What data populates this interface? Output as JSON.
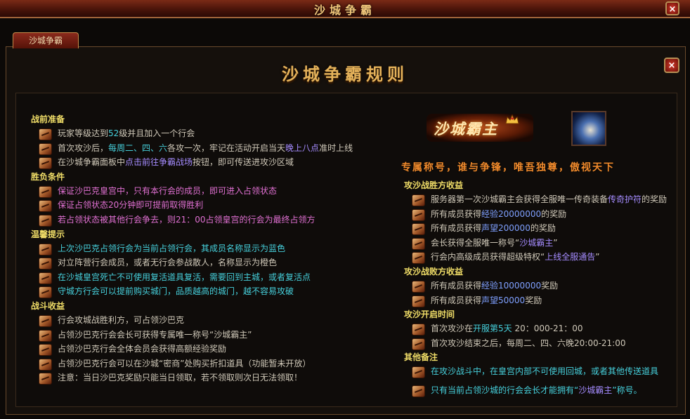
{
  "window": {
    "title": "沙城争霸",
    "close_label": "×"
  },
  "tab": {
    "label": "沙城争霸"
  },
  "panel": {
    "title": "沙城争霸规则",
    "close_label": "×"
  },
  "logo": {
    "text": "沙城霸主"
  },
  "slogan": "专属称号，谁与争锋，唯吾独尊，傲视天下",
  "left_sections": [
    {
      "heading": "战前准备",
      "items": [
        {
          "parts": [
            {
              "t": "玩家等级达到",
              "c": "white"
            },
            {
              "t": "52",
              "c": "cyan"
            },
            {
              "t": "级并且加入一个行会",
              "c": "white"
            }
          ]
        },
        {
          "parts": [
            {
              "t": "首次攻沙后，",
              "c": "white"
            },
            {
              "t": "每周二、四、六",
              "c": "cyan"
            },
            {
              "t": "各攻一次，牢记在活动开启当天",
              "c": "white"
            },
            {
              "t": "晚上八点",
              "c": "purple"
            },
            {
              "t": "准时上线",
              "c": "white"
            }
          ]
        },
        {
          "parts": [
            {
              "t": "在沙城争霸面板中",
              "c": "white"
            },
            {
              "t": "点击前往争霸战场",
              "c": "purple"
            },
            {
              "t": "按钮，即可传送进攻沙区域",
              "c": "white"
            }
          ]
        }
      ]
    },
    {
      "heading": "胜负条件",
      "items": [
        {
          "parts": [
            {
              "t": "保证沙巴克皇宫中，只有本行会的成员，即可进入占领状态",
              "c": "pink"
            }
          ]
        },
        {
          "parts": [
            {
              "t": "保证占领状态20分钟即可提前取得胜利",
              "c": "pink"
            }
          ]
        },
        {
          "parts": [
            {
              "t": "若占领状态被其他行会争去，则21：00占领皇宫的行会为最终占领方",
              "c": "pink"
            }
          ]
        }
      ]
    },
    {
      "heading": "温馨提示",
      "items": [
        {
          "parts": [
            {
              "t": "上次沙巴克占领行会为当前占领行会，其成员名称显示为蓝色",
              "c": "cyan"
            }
          ]
        },
        {
          "parts": [
            {
              "t": "对立阵营行会成员，或者无行会参战散人，名称显示为橙色",
              "c": "white"
            }
          ]
        },
        {
          "parts": [
            {
              "t": "在沙城皇宫死亡不可使用复活道具复活，需要回到主城，或者复活点",
              "c": "cyan"
            }
          ]
        },
        {
          "parts": [
            {
              "t": "守城方行会可以提前购买城门，品质越高的城门，越不容易攻破",
              "c": "cyan"
            }
          ]
        }
      ]
    },
    {
      "heading": "战斗收益",
      "items": [
        {
          "parts": [
            {
              "t": "行会攻城战胜利方，可占领沙巴克",
              "c": "white"
            }
          ]
        },
        {
          "parts": [
            {
              "t": "占领沙巴克行会会长可获得专属唯一称号“沙城霸主”",
              "c": "white"
            }
          ]
        },
        {
          "parts": [
            {
              "t": "占领沙巴克行会全体会员会获得高额经验奖励",
              "c": "white"
            }
          ]
        },
        {
          "parts": [
            {
              "t": "占领沙巴克行会可以在沙城“密商”处购买折扣道具（功能暂未开放）",
              "c": "white"
            }
          ]
        },
        {
          "parts": [
            {
              "t": "注意：当日沙巴克奖励只能当日领取，若不领取则次日无法领取！",
              "c": "white"
            }
          ]
        }
      ]
    }
  ],
  "right_sections": [
    {
      "heading": "攻沙战胜方收益",
      "items": [
        {
          "parts": [
            {
              "t": "服务器第一次沙城霸主会获得全服唯一传奇装备",
              "c": "white"
            },
            {
              "t": "传奇护符",
              "c": "purple"
            },
            {
              "t": "的奖励",
              "c": "white"
            }
          ]
        },
        {
          "parts": [
            {
              "t": "所有成员获得",
              "c": "white"
            },
            {
              "t": "经验20000000",
              "c": "blue"
            },
            {
              "t": "的奖励",
              "c": "white"
            }
          ]
        },
        {
          "parts": [
            {
              "t": "所有成员获得",
              "c": "white"
            },
            {
              "t": "声望200000",
              "c": "blue"
            },
            {
              "t": "的奖励",
              "c": "white"
            }
          ]
        },
        {
          "parts": [
            {
              "t": "会长获得全服唯一称号“",
              "c": "white"
            },
            {
              "t": "沙城霸主",
              "c": "purple"
            },
            {
              "t": "”",
              "c": "white"
            }
          ]
        },
        {
          "parts": [
            {
              "t": "行会内高级成员获得超级特权“",
              "c": "white"
            },
            {
              "t": "上线全服通告",
              "c": "purple"
            },
            {
              "t": "”",
              "c": "white"
            }
          ]
        }
      ]
    },
    {
      "heading": "攻沙战败方收益",
      "items": [
        {
          "parts": [
            {
              "t": "所有成员获得",
              "c": "white"
            },
            {
              "t": "经验10000000",
              "c": "blue"
            },
            {
              "t": "奖励",
              "c": "white"
            }
          ]
        },
        {
          "parts": [
            {
              "t": "所有成员获得",
              "c": "white"
            },
            {
              "t": "声望50000",
              "c": "blue"
            },
            {
              "t": "奖励",
              "c": "white"
            }
          ]
        }
      ]
    },
    {
      "heading": "攻沙开启时间",
      "items": [
        {
          "parts": [
            {
              "t": "首次攻沙在",
              "c": "white"
            },
            {
              "t": "开服第5天",
              "c": "cyan"
            },
            {
              "t": " 20：000-21：00",
              "c": "white"
            }
          ]
        },
        {
          "parts": [
            {
              "t": "首次攻沙结束之后，每周二、四、六晚20:00-21:00",
              "c": "white"
            }
          ]
        }
      ]
    },
    {
      "heading": "其他备注",
      "items": [
        {
          "parts": [
            {
              "t": "在攻沙战斗中，在皇宫内部不可使用回城，或者其他传送道具",
              "c": "cyan"
            }
          ]
        },
        {
          "gap": true,
          "parts": [
            {
              "t": "只有当前占领沙城的行会会长才能拥有“",
              "c": "cyan"
            },
            {
              "t": "沙城霸主",
              "c": "purple"
            },
            {
              "t": "”称号。",
              "c": "cyan"
            }
          ]
        }
      ]
    }
  ],
  "icons": {
    "window_close": "close-icon",
    "panel_close": "close-icon",
    "bullet": "scroll-icon",
    "badge": "title-badge-icon"
  },
  "colors": {
    "heading": "#f1de68",
    "white": "#cfc8b8",
    "pink": "#e070d2",
    "cyan": "#46d0dc",
    "purple": "#a58cff",
    "blue": "#7fa0ff",
    "slogan": "#f08a2c"
  }
}
